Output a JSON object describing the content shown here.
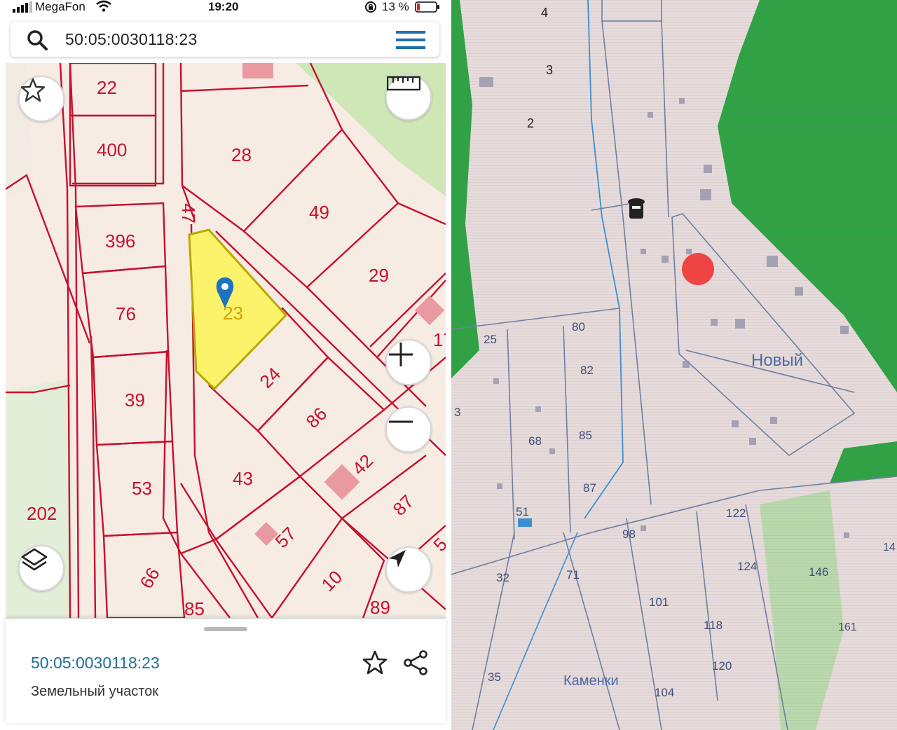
{
  "status_bar": {
    "carrier": "MegaFon",
    "time": "19:20",
    "battery": "13 %",
    "icons": [
      "signal-icon",
      "wifi-icon",
      "orientation-lock-icon",
      "battery-icon"
    ]
  },
  "search": {
    "query": "50:05:0030118:23",
    "icon": "search-icon",
    "menu_icon": "hamburger-menu-icon"
  },
  "map_left": {
    "parcel_labels": [
      "22",
      "400",
      "396",
      "76",
      "39",
      "53",
      "202",
      "66",
      "85",
      "28",
      "47",
      "49",
      "29",
      "17",
      "23",
      "24",
      "86",
      "43",
      "42",
      "57",
      "87",
      "10",
      "89",
      "5"
    ],
    "selected_parcel": "23",
    "colors": {
      "boundary": "#c8102e",
      "selected_fill": "#fdf36b",
      "land": "#f6ece4",
      "green": "#cfe6b6",
      "pin": "#1e73be"
    },
    "buttons": {
      "favorite": "star-icon",
      "ruler": "ruler-icon",
      "zoom_in": "plus-icon",
      "zoom_out": "minus-icon",
      "layers": "layers-icon",
      "locate": "navigation-arrow-icon"
    }
  },
  "info_sheet": {
    "parcel_id": "50:05:0030118:23",
    "parcel_type": "Земельный участок",
    "icons": [
      "star-icon",
      "share-icon"
    ]
  },
  "map_right": {
    "place_label": "Новый",
    "street_label": "Каменки",
    "labels": [
      "4",
      "3",
      "2",
      "25",
      "80",
      "82",
      "3",
      "68",
      "85",
      "87",
      "51",
      "98",
      "122",
      "32",
      "71",
      "101",
      "124",
      "146",
      "118",
      "14",
      "161",
      "120",
      "35",
      "104"
    ],
    "colors": {
      "forest": "#2fa244",
      "land": "#e6dada",
      "line": "#6e7fa0",
      "water_line": "#3a8fd0",
      "marker": "#ef4444"
    }
  }
}
